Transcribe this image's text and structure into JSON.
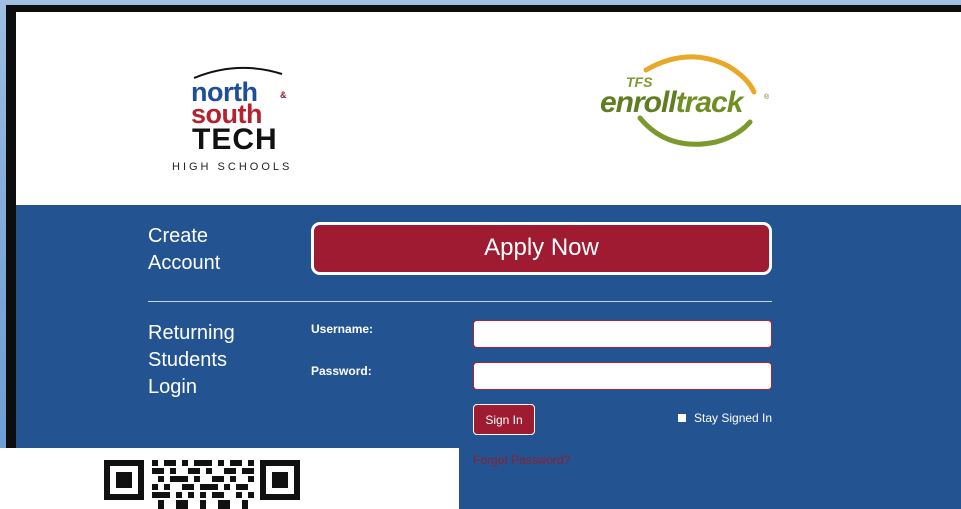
{
  "header": {
    "nst_logo": {
      "north": "north",
      "amp": "&",
      "south": "south",
      "tech": "TECH",
      "subtitle": "HIGH SCHOOLS"
    },
    "enrolltrack_logo": {
      "tfs": "TFS",
      "enroll": "enroll",
      "track": "track",
      "reg": "®"
    }
  },
  "create_account": {
    "label_line1": "Create",
    "label_line2": "Account",
    "apply_button": "Apply Now"
  },
  "login": {
    "label_line1": "Returning",
    "label_line2": "Students",
    "label_line3": "Login",
    "username_label": "Username:",
    "password_label": "Password:",
    "username_value": "",
    "password_value": "",
    "signin_button": "Sign In",
    "stay_signed_in": "Stay Signed In",
    "forgot_password": "Forgot Password?"
  },
  "colors": {
    "panel_blue": "#235391",
    "button_red": "#9e1b32",
    "enrolltrack_green": "#5f7d21",
    "north_blue": "#1e4e9a",
    "south_red": "#b5222f"
  },
  "icons": {
    "qr": "qr-code-icon",
    "checkbox": "checkbox-icon"
  }
}
